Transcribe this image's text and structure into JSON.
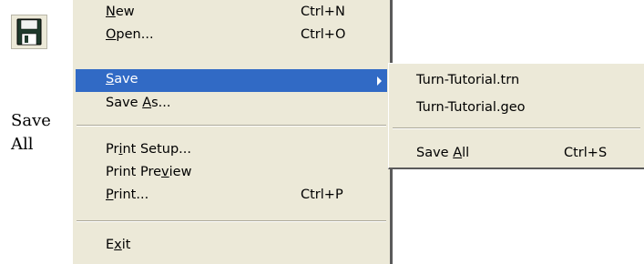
{
  "toolbar": {
    "save_icon": "floppy-disk-icon",
    "caption_line1": "Save",
    "caption_line2": "All"
  },
  "menu": {
    "items": [
      {
        "pre": "",
        "acc": "N",
        "post": "ew",
        "shortcut": "Ctrl+N"
      },
      {
        "pre": "",
        "acc": "O",
        "post": "pen...",
        "shortcut": "Ctrl+O"
      },
      {
        "pre": "",
        "acc": "S",
        "post": "ave",
        "shortcut": "",
        "submenu": true,
        "selected": true
      },
      {
        "pre": "Save ",
        "acc": "A",
        "post": "s...",
        "shortcut": ""
      },
      {
        "pre": "Pr",
        "acc": "i",
        "post": "nt Setup...",
        "shortcut": ""
      },
      {
        "pre": "Print Pre",
        "acc": "v",
        "post": "iew",
        "shortcut": ""
      },
      {
        "pre": "",
        "acc": "P",
        "post": "rint...",
        "shortcut": "Ctrl+P"
      },
      {
        "pre": "E",
        "acc": "x",
        "post": "it",
        "shortcut": ""
      }
    ]
  },
  "submenu": {
    "items": [
      {
        "label": "Turn-Tutorial.trn",
        "shortcut": ""
      },
      {
        "label": "Turn-Tutorial.geo",
        "shortcut": ""
      },
      {
        "pre": "Save ",
        "acc": "A",
        "post": "ll",
        "shortcut": "Ctrl+S"
      }
    ]
  },
  "colors": {
    "menu_bg": "#ece9d8",
    "highlight": "#316ac5",
    "highlight_text": "#ffffff"
  }
}
